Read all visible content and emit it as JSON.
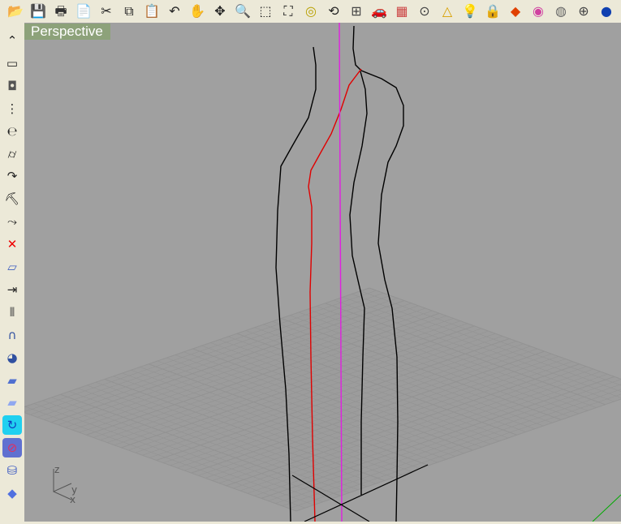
{
  "toolbar": {
    "items": [
      {
        "name": "open-icon",
        "glyph": "📂",
        "color": "#d8a520"
      },
      {
        "name": "save-icon",
        "glyph": "💾",
        "color": "#555"
      },
      {
        "name": "print-icon",
        "glyph": "🖶",
        "color": "#333"
      },
      {
        "name": "import-icon",
        "glyph": "📄",
        "color": "#333"
      },
      {
        "name": "cut-icon",
        "glyph": "✂",
        "color": "#222"
      },
      {
        "name": "copy-icon",
        "glyph": "⧉",
        "color": "#222"
      },
      {
        "name": "paste-icon",
        "glyph": "📋",
        "color": "#d8c020"
      },
      {
        "name": "undo-icon",
        "glyph": "↶",
        "color": "#222"
      },
      {
        "name": "pan-icon",
        "glyph": "✋",
        "color": "#222"
      },
      {
        "name": "rotate-view-icon",
        "glyph": "✥",
        "color": "#222"
      },
      {
        "name": "zoom-dynamic-icon",
        "glyph": "🔍",
        "color": "#222"
      },
      {
        "name": "zoom-window-icon",
        "glyph": "⬚",
        "color": "#222"
      },
      {
        "name": "zoom-extents-icon",
        "glyph": "⛶",
        "color": "#222"
      },
      {
        "name": "zoom-selected-icon",
        "glyph": "◎",
        "color": "#b8a000"
      },
      {
        "name": "undo-view-icon",
        "glyph": "⟲",
        "color": "#222"
      },
      {
        "name": "four-viewports-icon",
        "glyph": "⊞",
        "color": "#444"
      },
      {
        "name": "car-icon",
        "glyph": "🚗",
        "color": "#c00"
      },
      {
        "name": "grid-snap-icon",
        "glyph": "▦",
        "color": "#c44"
      },
      {
        "name": "osnap-icon",
        "glyph": "⊙",
        "color": "#444"
      },
      {
        "name": "select-icon",
        "glyph": "△",
        "color": "#d8a000"
      },
      {
        "name": "light-icon",
        "glyph": "💡",
        "color": "#888"
      },
      {
        "name": "lock-icon",
        "glyph": "🔒",
        "color": "#444"
      },
      {
        "name": "layers-icon",
        "glyph": "◆",
        "color": "#e04000"
      },
      {
        "name": "color-wheel-icon",
        "glyph": "◉",
        "color": "#d040a0"
      },
      {
        "name": "shaded-sphere-icon",
        "glyph": "◍",
        "color": "#666"
      },
      {
        "name": "wireframe-sphere-icon",
        "glyph": "⊕",
        "color": "#444"
      },
      {
        "name": "render-sphere-icon",
        "glyph": "●",
        "color": "#1040b0"
      }
    ]
  },
  "sidebar": {
    "items": [
      {
        "name": "polyline-icon",
        "glyph": "⌃",
        "color": "#222"
      },
      {
        "name": "curve-icon",
        "glyph": "▭",
        "color": "#222"
      },
      {
        "name": "circle-icon",
        "glyph": "◘",
        "color": "#555"
      },
      {
        "name": "rebuild-curve-icon",
        "glyph": "⋮",
        "color": "#222"
      },
      {
        "name": "revolve-icon",
        "glyph": "℮",
        "color": "#222"
      },
      {
        "name": "cylinder-curve-icon",
        "glyph": "⌭",
        "color": "#222"
      },
      {
        "name": "fillet-icon",
        "glyph": "↷",
        "color": "#222"
      },
      {
        "name": "worker-icon",
        "glyph": "⛏",
        "color": "#111"
      },
      {
        "name": "offset-icon",
        "glyph": "⤳",
        "color": "#222"
      },
      {
        "name": "delete-point-icon",
        "glyph": "✕",
        "color": "#e00"
      },
      {
        "name": "surface-icon",
        "glyph": "▱",
        "color": "#4060c0"
      },
      {
        "name": "dimension-icon",
        "glyph": "⇥",
        "color": "#222"
      },
      {
        "name": "mirror-icon",
        "glyph": "⫴",
        "color": "#444"
      },
      {
        "name": "arch-icon",
        "glyph": "∩",
        "color": "#3050a0"
      },
      {
        "name": "patch-icon",
        "glyph": "◕",
        "color": "#3050a0"
      },
      {
        "name": "plane-surface-icon",
        "glyph": "▰",
        "color": "#5070d0"
      },
      {
        "name": "loft-icon",
        "glyph": "▰",
        "color": "#90a8f0"
      },
      {
        "name": "rotate-icon",
        "glyph": "↻",
        "color": "#1040c0",
        "bg": "#20d0f0"
      },
      {
        "name": "sphere-icon",
        "glyph": "⊘",
        "color": "#e03060",
        "bg": "#6070d0"
      },
      {
        "name": "cylinder-icon",
        "glyph": "⛁",
        "color": "#3050c0"
      },
      {
        "name": "diamond-icon",
        "glyph": "◆",
        "color": "#5070e0"
      }
    ]
  },
  "viewport": {
    "label": "Perspective",
    "axis_labels": {
      "z": "z",
      "y": "y",
      "x": "x"
    }
  },
  "colors": {
    "background": "#a0a0a0",
    "grid": "#939393",
    "curve": "#000000",
    "red_curve": "#e00000",
    "magenta_axis": "#e020e0"
  }
}
